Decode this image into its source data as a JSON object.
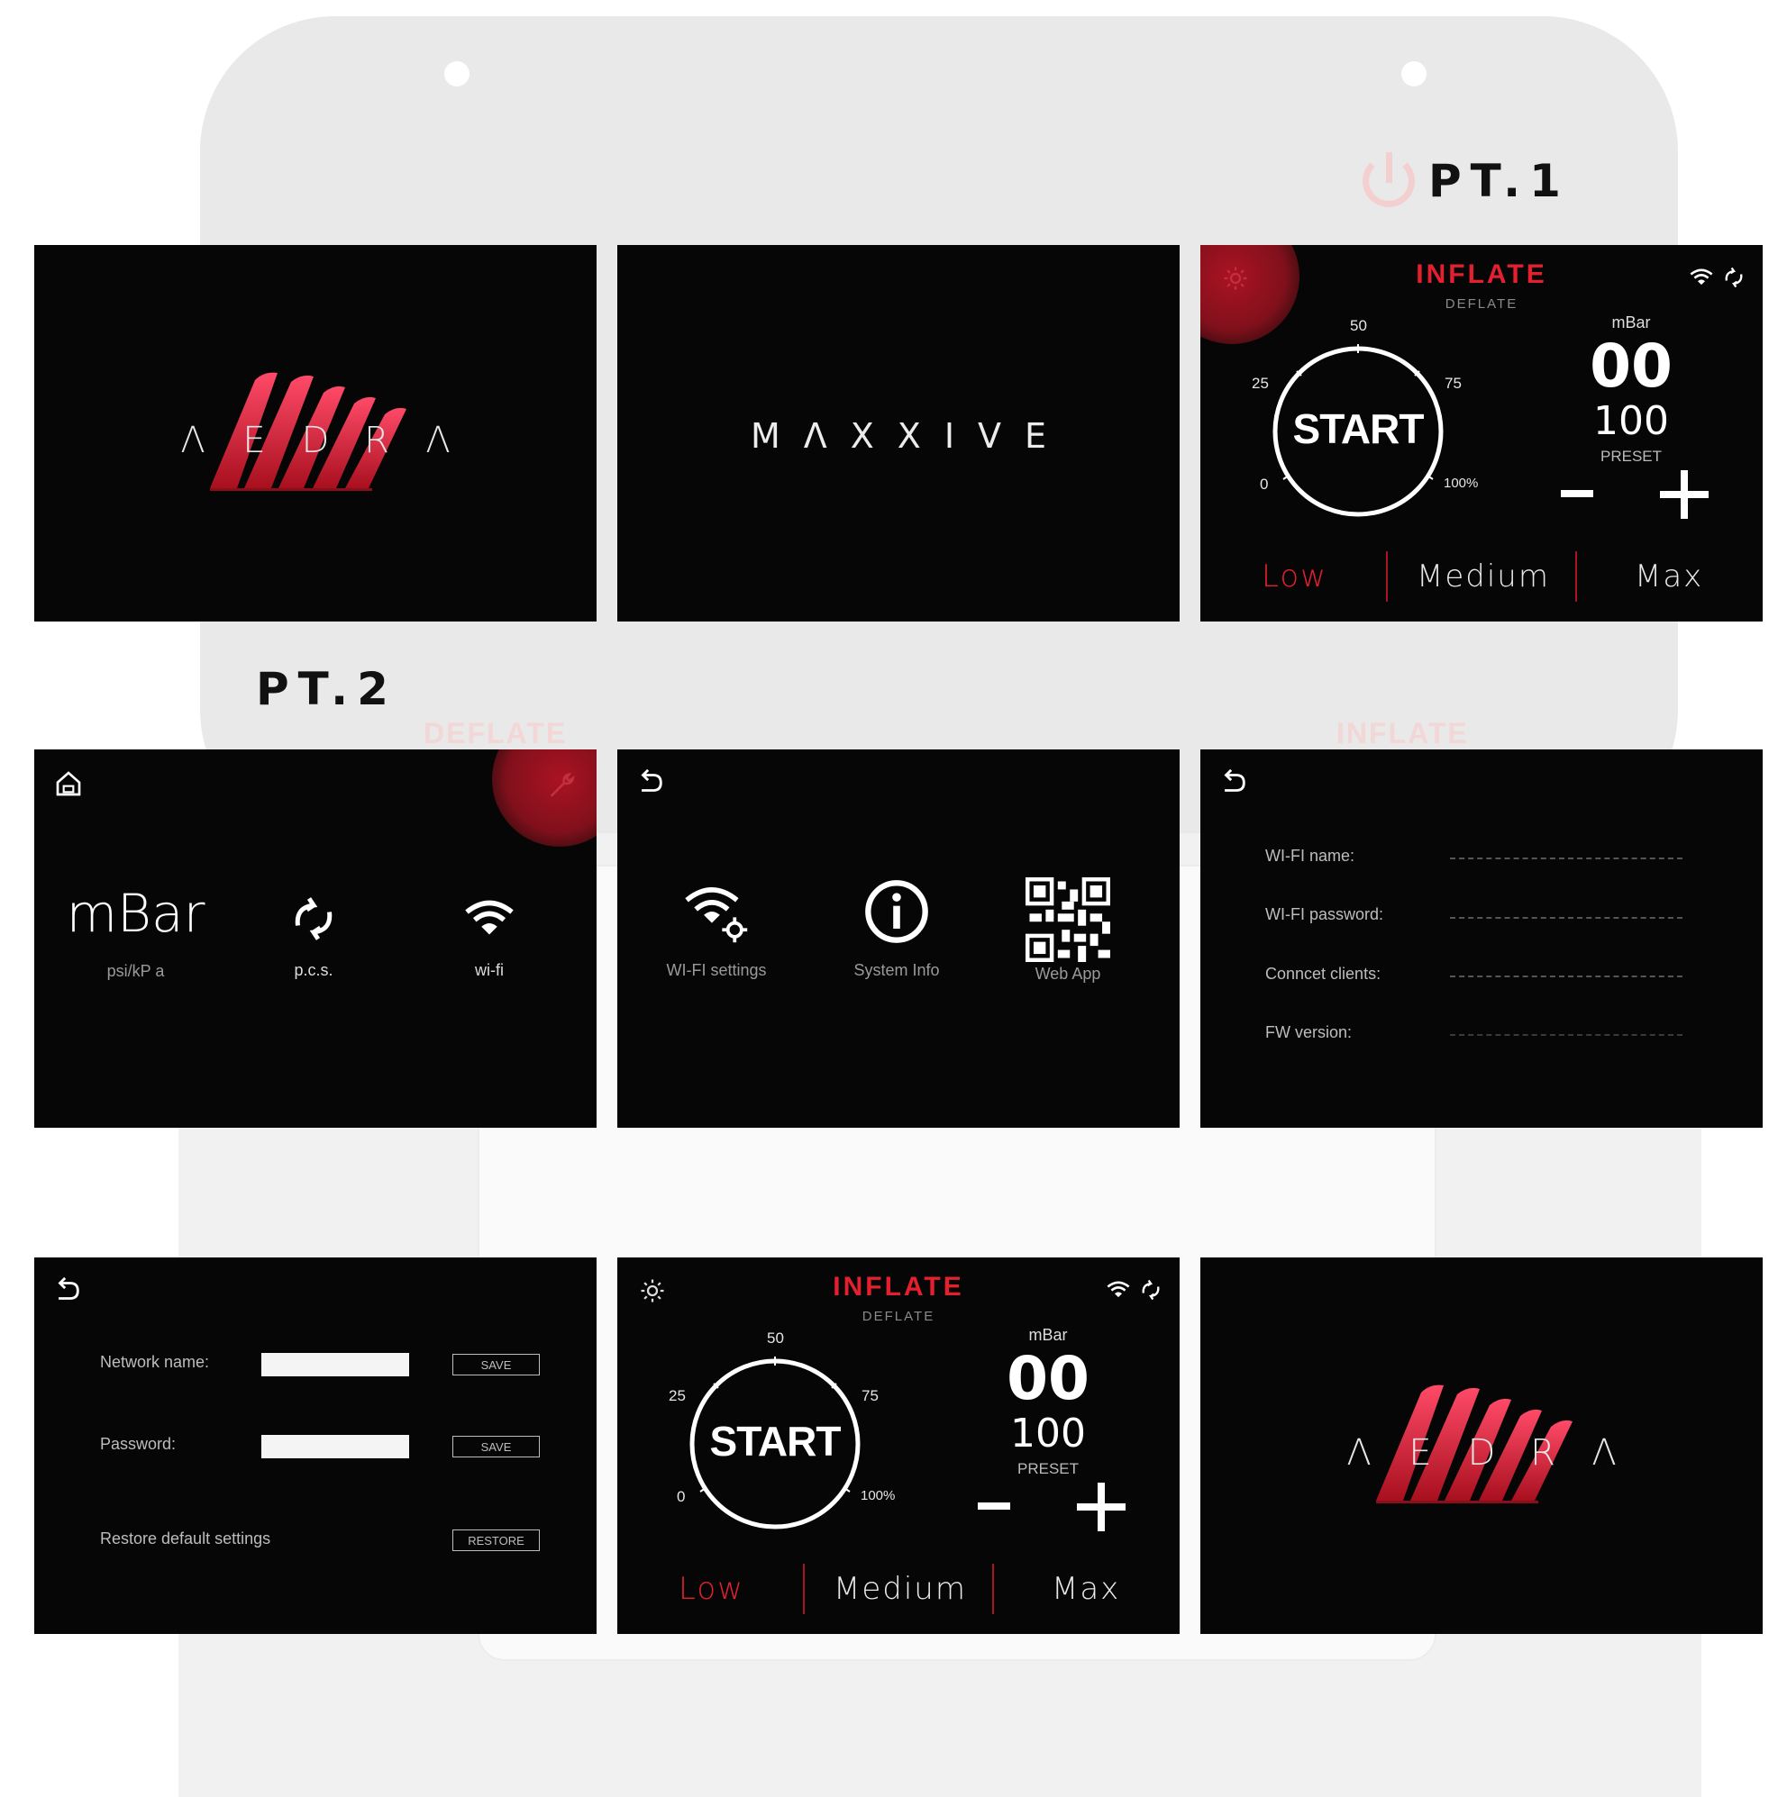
{
  "section_labels": {
    "pt1": "PT.1",
    "pt2": "PT.2"
  },
  "backdrop": {
    "left_ghost": "DEFLATE",
    "right_ghost": "INFLATE"
  },
  "logo_screen": {
    "letters": [
      "Λ",
      "E",
      "D",
      "R",
      "Λ"
    ],
    "brand_color": "#e4202f"
  },
  "maxxive_screen": {
    "text": "MΛXXIVE"
  },
  "control_screen": {
    "title": "INFLATE",
    "subtitle": "DEFLATE",
    "start_label": "START",
    "dial_ticks": [
      "0",
      "25",
      "50",
      "75",
      "100%"
    ],
    "unit": "mBar",
    "current_value": "00",
    "preset_value": "100",
    "preset_label": "PRESET",
    "modes": [
      "Low",
      "Medium",
      "Max"
    ],
    "active_mode": "Low",
    "accent_color": "#e4202f",
    "icons": [
      "gear-icon",
      "wifi-icon",
      "sync-icon"
    ]
  },
  "settings_menu": {
    "items": [
      {
        "big": "mBar",
        "caption": "psi/kP a"
      },
      {
        "caption": "p.c.s."
      },
      {
        "caption": "wi-fi"
      }
    ]
  },
  "settings_submenu": {
    "items": [
      {
        "caption": "WI-FI settings"
      },
      {
        "caption": "System Info"
      },
      {
        "caption": "Web App"
      }
    ]
  },
  "wifi_info": {
    "rows": [
      "WI-FI name:",
      "WI-FI password:",
      "Conncet clients:",
      "FW version:"
    ]
  },
  "network_form": {
    "network_label": "Network name:",
    "password_label": "Password:",
    "restore_label": "Restore default settings",
    "save_label": "SAVE",
    "restore_button": "RESTORE"
  }
}
